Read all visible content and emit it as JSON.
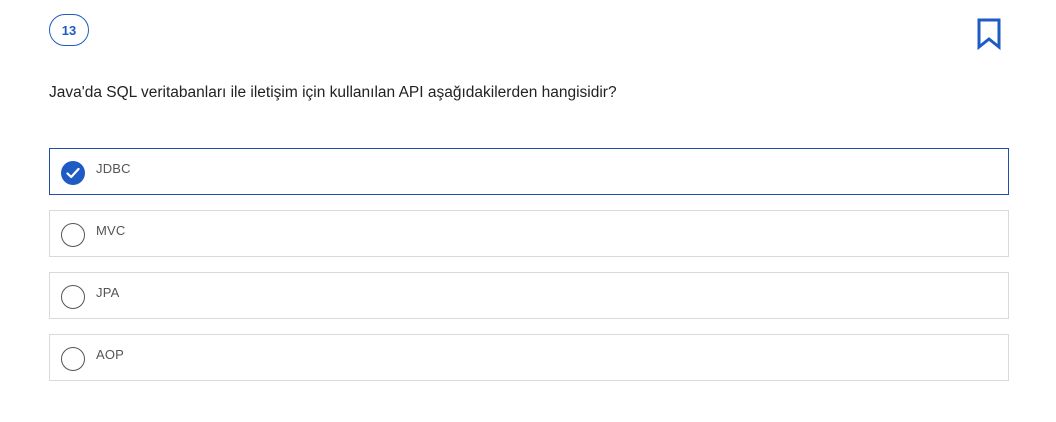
{
  "question": {
    "number": "13",
    "text": "Java'da SQL veritabanları ile iletişim için kullanılan API aşağıdakilerden hangisidir?"
  },
  "options": [
    {
      "label": "JDBC",
      "selected": true
    },
    {
      "label": "MVC",
      "selected": false
    },
    {
      "label": "JPA",
      "selected": false
    },
    {
      "label": "AOP",
      "selected": false
    }
  ],
  "icons": {
    "bookmark": "bookmark-icon",
    "check": "check-icon"
  },
  "colors": {
    "accent": "#1f5bc4",
    "selected_border": "#1f4fa8",
    "border": "#d9d9d9",
    "text": "#222222"
  }
}
